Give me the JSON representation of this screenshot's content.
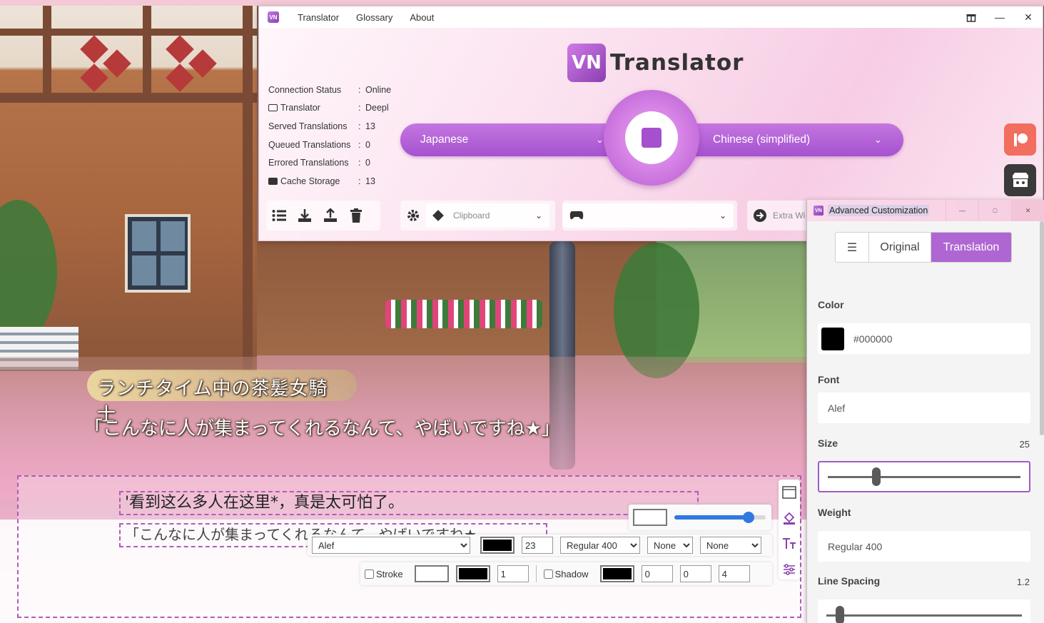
{
  "main_window": {
    "menu": [
      "Translator",
      "Glossary",
      "About"
    ],
    "logo_badge": "VN",
    "logo_text": "Translator",
    "stats": [
      {
        "label": "Connection Status",
        "value": "Online"
      },
      {
        "label": "Translator",
        "value": "Deepl"
      },
      {
        "label": "Served Translations",
        "value": "13"
      },
      {
        "label": "Queued Translations",
        "value": "0"
      },
      {
        "label": "Errored Translations",
        "value": "0"
      },
      {
        "label": "Cache Storage",
        "value": "13"
      }
    ],
    "stat_separator": ":",
    "source_language": "Japanese",
    "target_language": "Chinese (simplified)",
    "capture_source": "Clipboard",
    "extra_window_placeholder": "Extra Wi"
  },
  "game": {
    "speaker_name": "ランチタイム中の茶髪女騎士",
    "dialogue": "「こんなに人が集まってくれるなんて、やばいですね★」"
  },
  "overlay": {
    "translated_line": "'看到这么多人在这里*，真是太可怕了。",
    "original_line": "「こんなに人が集まってくれるなんて、やばいですね★",
    "font": "Alef",
    "font_size": "23",
    "weight": "Regular 400",
    "decoration": "None",
    "transform": "None",
    "stroke_label": "Stroke",
    "stroke_width": "1",
    "shadow_label": "Shadow",
    "shadow_x": "0",
    "shadow_y": "0",
    "shadow_blur": "4",
    "slider_fraction": 0.81,
    "colors": {
      "text": "#000000",
      "stroke_primary": "#ffffff",
      "stroke_secondary": "#000000",
      "shadow": "#000000"
    }
  },
  "advanced": {
    "title": "Advanced Customization",
    "tabs": [
      "☰",
      "Original",
      "Translation"
    ],
    "active_tab": "Translation",
    "color_label": "Color",
    "color_value": "#000000",
    "font_label": "Font",
    "font_value": "Alef",
    "size_label": "Size",
    "size_value": "25",
    "size_fraction": 0.25,
    "weight_label": "Weight",
    "weight_value": "Regular 400",
    "line_spacing_label": "Line Spacing",
    "line_spacing_value": "1.2",
    "line_spacing_fraction": 0.07
  },
  "colors": {
    "accent": "#a552cf",
    "patreon": "#f26e5e",
    "itch": "#3a3a3a"
  }
}
